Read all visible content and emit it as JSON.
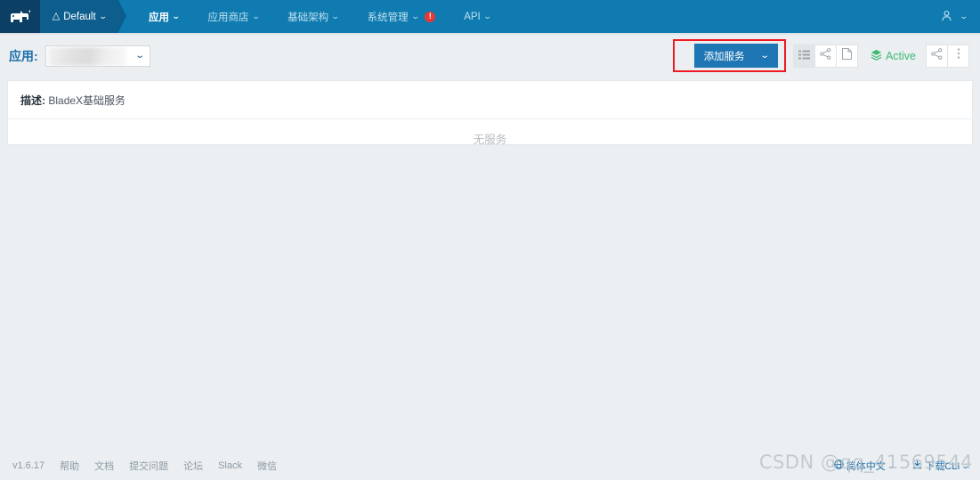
{
  "navbar": {
    "logo_icon": "rancher-cow-logo",
    "cluster": {
      "home_icon": "home-icon",
      "label": "Default",
      "caret": "⌄"
    },
    "items": [
      {
        "label": "应用",
        "caret": "⌄",
        "active": true,
        "badge": ""
      },
      {
        "label": "应用商店",
        "caret": "⌄",
        "active": false,
        "badge": ""
      },
      {
        "label": "基础架构",
        "caret": "⌄",
        "active": false,
        "badge": ""
      },
      {
        "label": "系统管理",
        "caret": "⌄",
        "active": false,
        "badge": "!"
      },
      {
        "label": "API",
        "caret": "⌄",
        "active": false,
        "badge": ""
      }
    ],
    "user": {
      "icon": "user-avatar-icon",
      "caret": "⌄"
    }
  },
  "toolbar": {
    "label": "应用:",
    "app_select": {
      "value": "",
      "caret": "⌄"
    },
    "add_service_button": {
      "label": "添加服务",
      "caret": "⌄"
    },
    "icons": [
      {
        "name": "list-view-icon",
        "active": true
      },
      {
        "name": "share-icon",
        "active": false
      },
      {
        "name": "document-icon",
        "active": false
      }
    ],
    "status": {
      "icon": "layers-icon",
      "label": "Active"
    },
    "trailing_icons": [
      {
        "name": "share-icon"
      },
      {
        "name": "kebab-menu-icon"
      }
    ]
  },
  "card": {
    "desc_label": "描述:",
    "desc_value": "BladeX基础服务",
    "empty_message": "无服务"
  },
  "footer": {
    "version": "v1.6.17",
    "links": [
      "帮助",
      "文档",
      "提交问题",
      "论坛",
      "Slack",
      "微信"
    ],
    "language": {
      "icon": "globe-icon",
      "label": "简体中文",
      "caret": "⌄"
    },
    "cli": {
      "icon": "download-icon",
      "label": "下载CLI",
      "caret": "⌄"
    }
  },
  "watermark": {
    "text": "CSDN @qq_41569544"
  },
  "colors": {
    "navbar": "#0f7bb0",
    "navbar_dark": "#0b3f63",
    "cluster": "#0d5e8c",
    "primary_button": "#1f76b4",
    "annotation": "#ee1c22",
    "status_active": "#3dbb73",
    "page_background": "#eceff1",
    "label_blue": "#1b6ea8"
  }
}
